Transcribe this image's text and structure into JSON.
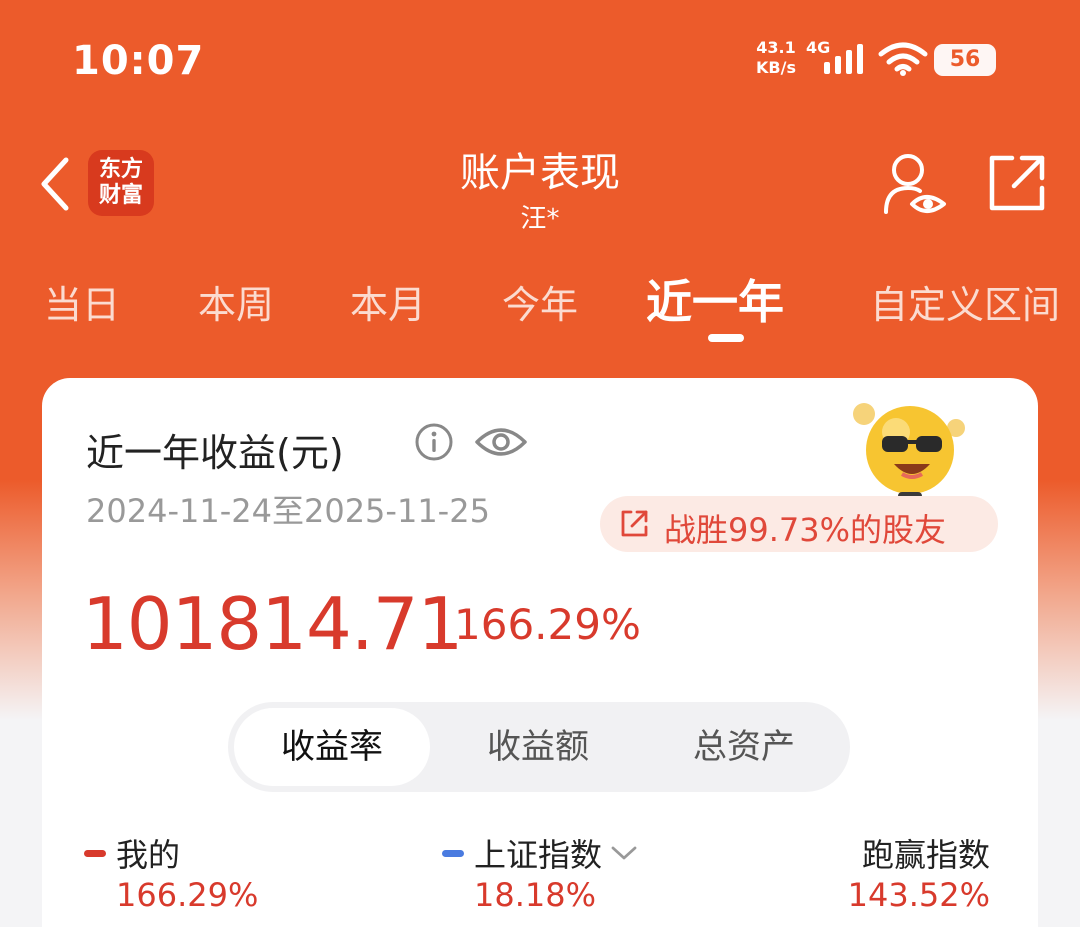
{
  "status": {
    "time": "10:07",
    "net_speed": "43.1",
    "net_unit": "KB/s",
    "net_type": "4G",
    "battery": "56"
  },
  "header": {
    "brand_line1": "东方",
    "brand_line2": "财富",
    "title": "账户表现",
    "subtitle": "汪*"
  },
  "tabs": [
    "当日",
    "本周",
    "本月",
    "今年",
    "近一年",
    "自定义区间"
  ],
  "active_tab": "近一年",
  "card": {
    "title": "近一年收益(元)",
    "date_range": "2024-11-24至2025-11-25",
    "beat_text": "战胜99.73%的股友",
    "profit_amount": "101814.71",
    "profit_rate": "166.29%"
  },
  "segments": [
    "收益率",
    "收益额",
    "总资产"
  ],
  "active_segment": "收益率",
  "legend": [
    {
      "label": "我的",
      "value": "166.29%",
      "color": "#D83A2C"
    },
    {
      "label": "上证指数",
      "value": "18.18%",
      "color": "#4A7BE0"
    },
    {
      "label": "跑赢指数",
      "value": "143.52%"
    }
  ],
  "colors": {
    "brand_orange": "#EC5B2B",
    "profit_red": "#D83A2C"
  }
}
